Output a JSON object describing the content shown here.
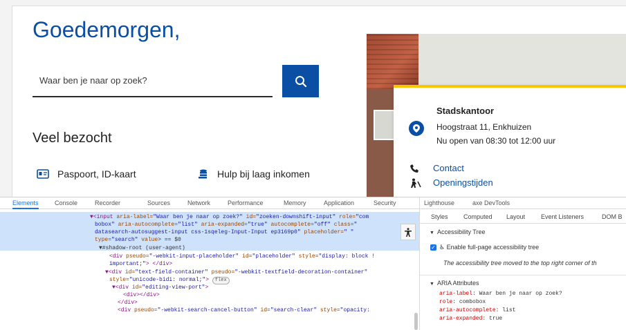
{
  "site": {
    "greeting": "Goedemorgen,",
    "search_placeholder": "Waar ben je naar op zoek?",
    "popular_heading": "Veel bezocht",
    "quick_links": [
      "Paspoort, ID-kaart",
      "Hulp bij laag inkomen"
    ],
    "location_card": {
      "title": "Stadskantoor",
      "address": "Hoogstraat 11, Enkhuizen",
      "hours": "Nu open van 08:30 tot 12:00 uur",
      "links": [
        "Contact",
        "Openingstijden"
      ]
    },
    "colors": {
      "brand": "#0a4fa3",
      "accent": "#f6c800"
    }
  },
  "devtools": {
    "tabs": [
      "Elements",
      "Console",
      "Recorder",
      "Sources",
      "Network",
      "Performance",
      "Memory",
      "Application",
      "Security",
      "Lighthouse",
      "axe DevTools"
    ],
    "active_tab": "Elements",
    "dom_lines": {
      "l1_tag": "▼<input",
      "l1_a1": " aria-label=",
      "l1_v1": "\"Waar ben je naar op zoek?\"",
      "l1_a2": " id=",
      "l1_v2": "\"zoeken-downshift-input\"",
      "l1_a3": " role=",
      "l1_v3": "\"com",
      "l2_v": "bobox\"",
      "l2_a1": " aria-autocomplete=",
      "l2_v1": "\"list\"",
      "l2_a2": " aria-expanded=",
      "l2_v2": "\"true\"",
      "l2_a3": " autocomplete=",
      "l2_v3": "\"off\"",
      "l2_a4": " class=",
      "l2_v4": "\"",
      "l3_v": "datasearch-autosuggest-input css-1sqeleg-Input-Input ep3169p0\"",
      "l3_a1": " placeholder=",
      "l3_v1": "\" \"",
      "l4_a1": "type=",
      "l4_v1": "\"search\"",
      "l4_a2": " value",
      "l4_p": "> == $0",
      "l5": "▼#shadow-root (user-agent)",
      "l6_tag": "<div",
      "l6_a1": " pseudo=",
      "l6_v1": "\"-webkit-input-placeholder\"",
      "l6_a2": " id=",
      "l6_v2": "\"placeholder\"",
      "l6_a3": " style=",
      "l6_v3": "\"display: block !",
      "l7_v": "important;\"",
      "l7_tag": "> </div>",
      "l8_tag": "▼<div",
      "l8_a1": " id=",
      "l8_v1": "\"text-field-container\"",
      "l8_a2": " pseudo=",
      "l8_v2": "\"-webkit-textfield-decoration-container\"",
      "l9_a1": "style=",
      "l9_v1": "\"unicode-bidi: normal;\"",
      "l9_tag": ">",
      "l9_badge": "flex",
      "l10_tag": "▼<div",
      "l10_a1": " id=",
      "l10_v1": "\"editing-view-port\"",
      "l10_tag2": ">",
      "l11": "<div></div>",
      "l12": "</div>",
      "l13_tag": "<div",
      "l13_a1": " pseudo=",
      "l13_v1": "\"-webkit-search-cancel-button\"",
      "l13_a2": " id=",
      "l13_v2": "\"search-clear\"",
      "l13_a3": " style=",
      "l13_v3": "\"opacity:"
    },
    "sidebar": {
      "tabs": [
        "Styles",
        "Computed",
        "Layout",
        "Event Listeners",
        "DOM B"
      ],
      "accessibility_tree_heading": "Accessibility Tree",
      "enable_label": "Enable full-page accessibility tree",
      "note": "The accessibility tree moved to the top right corner of th",
      "aria_heading": "ARIA Attributes",
      "aria": [
        {
          "key": "aria-label",
          "value": "Waar ben je naar op zoek?"
        },
        {
          "key": "role",
          "value": "combobox"
        },
        {
          "key": "aria-autocomplete",
          "value": "list"
        },
        {
          "key": "aria-expanded",
          "value": "true"
        }
      ]
    }
  }
}
